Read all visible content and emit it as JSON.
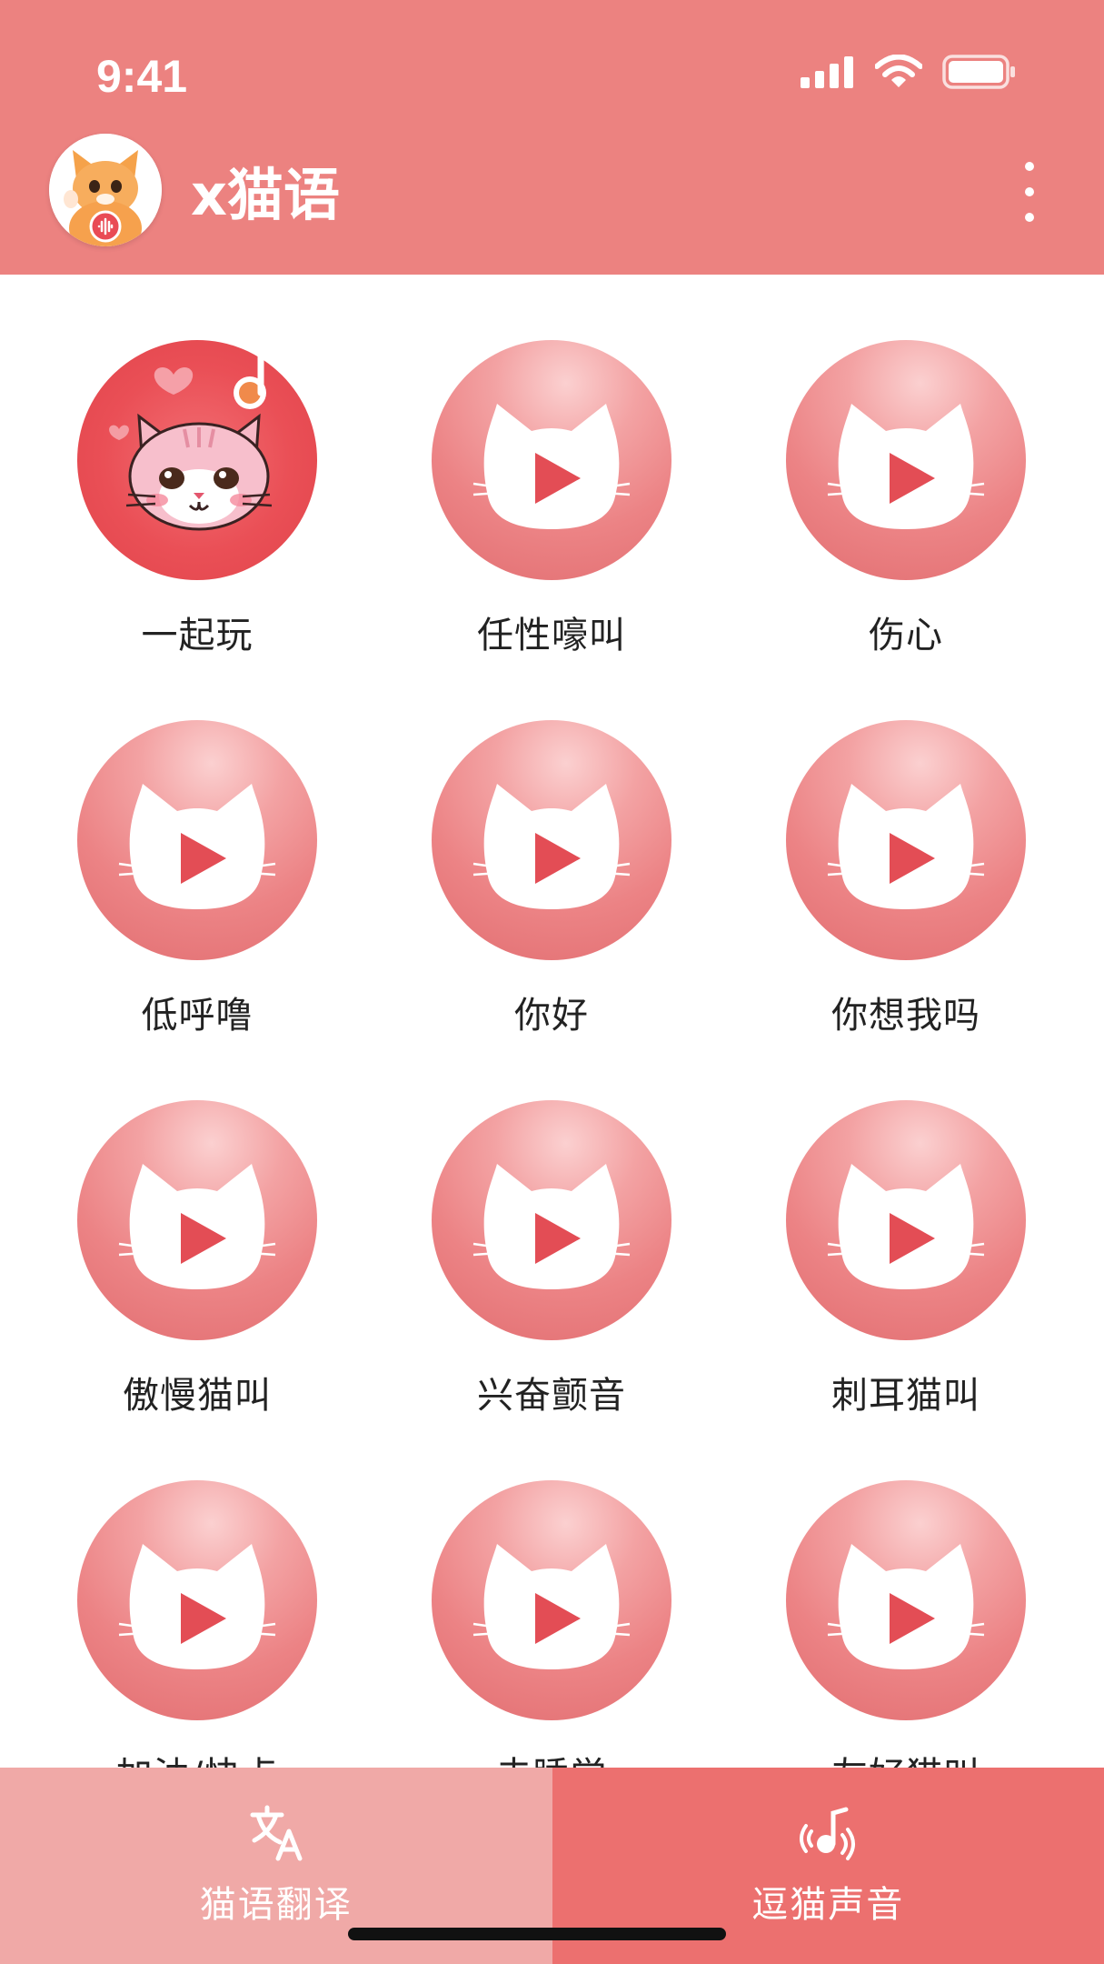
{
  "status_bar": {
    "time": "9:41"
  },
  "header": {
    "title": "x猫语",
    "bg_color": "#ec8280"
  },
  "grid": {
    "items": [
      {
        "label": "一起玩",
        "active": true
      },
      {
        "label": "任性嚎叫"
      },
      {
        "label": "伤心"
      },
      {
        "label": "低呼噜"
      },
      {
        "label": "你好"
      },
      {
        "label": "你想我吗"
      },
      {
        "label": "傲慢猫叫"
      },
      {
        "label": "兴奋颤音"
      },
      {
        "label": "刺耳猫叫"
      },
      {
        "label": "加油/快点"
      },
      {
        "label": "去睡觉"
      },
      {
        "label": "友好猫叫"
      }
    ]
  },
  "tabbar": {
    "tabs": [
      {
        "label": "猫语翻译",
        "icon": "translate-icon",
        "color": "#f0a9a7"
      },
      {
        "label": "逗猫声音",
        "icon": "music-sound-icon",
        "color": "#ec706f",
        "selected": true
      }
    ]
  },
  "colors": {
    "accent": "#ea4f56",
    "play": "#e34d55"
  }
}
